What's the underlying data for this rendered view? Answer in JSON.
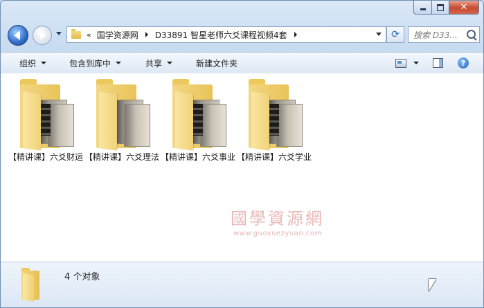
{
  "window": {
    "close_glyph": "✕"
  },
  "address_bar": {
    "overflow_chevron": "«",
    "crumbs": [
      "国学资源网",
      "D33891 智星老师六爻课程视频4套"
    ]
  },
  "search": {
    "placeholder": "搜索 D33..."
  },
  "toolbar": {
    "organize": "组织",
    "include_in_library": "包含到库中",
    "share": "共享",
    "new_folder": "新建文件夹",
    "help_glyph": "?"
  },
  "items": [
    {
      "label": "【精讲课】六爻财运"
    },
    {
      "label": "【精讲课】六爻理法"
    },
    {
      "label": "【精讲课】六爻事业"
    },
    {
      "label": "【精讲课】六爻学业"
    }
  ],
  "watermark": {
    "title": "國學資源網",
    "url": "www.guoxuezyuan.com"
  },
  "details": {
    "count": "4 个对象"
  },
  "icons": {
    "back": "back-arrow-icon",
    "forward": "forward-arrow-icon",
    "refresh": "refresh-icon",
    "search": "search-icon",
    "views": "change-view-icon",
    "preview_pane": "preview-pane-icon",
    "help": "help-icon",
    "folder": "folder-icon"
  }
}
